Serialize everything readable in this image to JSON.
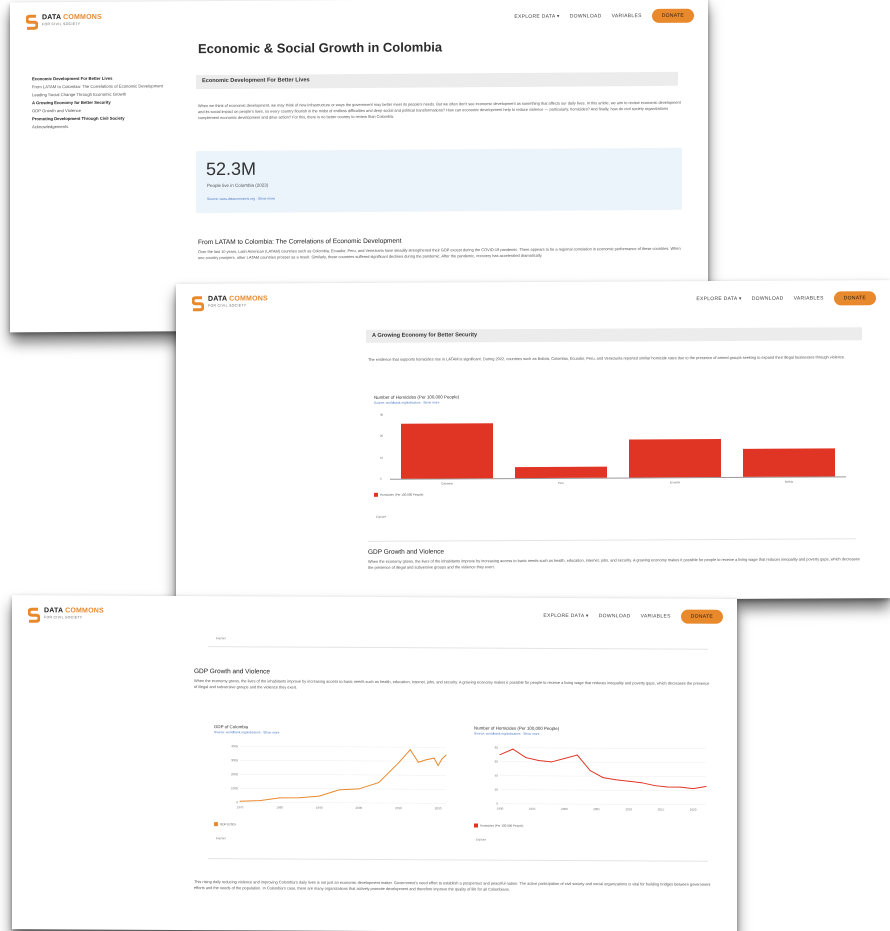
{
  "brand": {
    "name_prefix": "DATA",
    "name_suffix": "COMMONS",
    "tagline": "FOR CIVIL SOCIETY",
    "accent_color": "#e8892c"
  },
  "nav": {
    "explore": "EXPLORE DATA ▾",
    "download": "DOWNLOAD",
    "variables": "VARIABLES",
    "donate": "DONATE"
  },
  "page1": {
    "title": "Economic & Social Growth in Colombia",
    "toc": [
      {
        "label": "Economic Development For Better Lives",
        "bold": true
      },
      {
        "label": "From LATAM to Colombia: The Correlations of Economic Development",
        "bold": false
      },
      {
        "label": "Leading Social Change Through Economic Growth",
        "bold": false
      },
      {
        "label": "A Growing Economy for Better Security",
        "bold": true
      },
      {
        "label": "GDP Growth and Violence",
        "bold": false
      },
      {
        "label": "Promoting Development Through Civil Society",
        "bold": true
      },
      {
        "label": "Acknowledgements",
        "bold": false
      }
    ],
    "section_title": "Economic Development For Better Lives",
    "intro": "When we think of economic development, we may think of new infrastructure or ways the government may better meet its people's needs. But we often don't see economic development as something that affects our daily lives. In this article, we aim to review economic development and its social impact on people's lives, so every country flourish in the midst of endless difficulties and deep social and political transformations? How can economic development help to reduce violence — particularly, homicides? And finally, how do civil society organizations complement economic development and drive action? For this, there is no better country to review than Colombia.",
    "stat_value": "52.3M",
    "stat_label": "People live in Colombia (2023)",
    "stat_source": "Source: www.datacommons.org · Show more",
    "subheading": "From LATAM to Colombia: The Correlations of Economic Development",
    "body": "Over the last 10 years, Latin American (LATAM) countries such as Colombia, Ecuador, Peru, and Venezuela have steadily strengthened their GDP except during the COVID-19 pandemic. There appears to be a regional correlation in economic performance of these countries. When one country prospers, other LATAM countries prosper as a result. Similarly, these countries suffered significant declines during the pandemic. After the pandemic, recovery has accelerated dramatically."
  },
  "page2": {
    "section_title": "A Growing Economy for Better Security",
    "intro": "The evidence that supports homicides rise in LATAM is significant. During 2022, countries such as Bolivia, Colombia, Ecuador, Peru, and Venezuela reported similar homicide rates due to the presence of armed groups seeking to expand their illegal businesses through violence.",
    "subheading": "GDP Growth and Violence",
    "body": "When the economy grows, the lives of the inhabitants improve by increasing access to basic needs such as health, education, internet, jobs, and security. A growing economy makes it possible for people to receive a living wage that reduces inequality and poverty gaps, which decreases the presence of illegal and subversive groups and the violence they exert.",
    "explore_label": "Explore",
    "chart_data": {
      "type": "bar",
      "title": "Number of Homicides (Per 100,000 People)",
      "source": "Source: worldbank.org/indicators · Show more",
      "categories": [
        "Colombia",
        "Peru",
        "Ecuador",
        "Bolivia"
      ],
      "values": [
        26,
        5,
        18,
        13
      ],
      "ylim": [
        0,
        30
      ],
      "yticks": [
        "30",
        "20",
        "10",
        "0"
      ],
      "ylabel": "Homicides",
      "legend": "Homicides (Per 100,000 People)",
      "color": "#e03424"
    }
  },
  "page3": {
    "explore_top": "Explore",
    "subheading": "GDP Growth and Violence",
    "intro": "When the economy grows, the lives of the inhabitants improve by increasing access to basic needs such as health, education, internet, jobs, and security. A growing economy makes it possible for people to receive a living wage that reduces inequality and poverty gaps, which decreases the presence of illegal and subversive groups and the violence they exert.",
    "explore_label": "Explore",
    "closing": "This rising daily reducing violence and improving Colombia's daily lives is not just an economic development matter. Government's need effort to establish a prosperous and peaceful nation. The active participation of civil society and social organizations is vital for building bridges between government efforts and the needs of the population. In Colombia's case, there are many organizations that actively promote development and therefore improve the quality of life for all Colombians.",
    "chart_data": [
      {
        "type": "line",
        "title": "GDP of Colombia",
        "source": "Source: worldbank.org/indicators · Show more",
        "x": [
          1970,
          1975,
          1980,
          1985,
          1990,
          1995,
          2000,
          2005,
          2010,
          2013,
          2015,
          2017,
          2019,
          2020,
          2021,
          2022
        ],
        "values": [
          7,
          13,
          33,
          35,
          47,
          92,
          100,
          146,
          287,
          382,
          293,
          311,
          323,
          270,
          318,
          344
        ],
        "xticks": [
          "1970",
          "1980",
          "1990",
          "2000",
          "2010",
          "2020"
        ],
        "yticks": [
          "400B",
          "300B",
          "200B",
          "100B",
          "0"
        ],
        "ylim": [
          0,
          400
        ],
        "legend": "GDP (USD)",
        "color": "#e8892c"
      },
      {
        "type": "line",
        "title": "Number of Homicides (Per 100,000 People)",
        "source": "Source: worldbank.org/indicators · Show more",
        "x": [
          1990,
          1992,
          1994,
          1996,
          1998,
          2000,
          2002,
          2004,
          2006,
          2008,
          2010,
          2012,
          2014,
          2016,
          2018,
          2020,
          2022
        ],
        "values": [
          70,
          78,
          66,
          62,
          60,
          65,
          70,
          48,
          38,
          35,
          33,
          31,
          27,
          25,
          25,
          23,
          26
        ],
        "xticks": [
          "1990",
          "1995",
          "2000",
          "2005",
          "2010",
          "2015",
          "2020"
        ],
        "yticks": [
          "80",
          "60",
          "40",
          "20",
          "0"
        ],
        "ylim": [
          0,
          80
        ],
        "legend": "Homicides (Per 100,000 People)",
        "color": "#e03424"
      }
    ]
  }
}
